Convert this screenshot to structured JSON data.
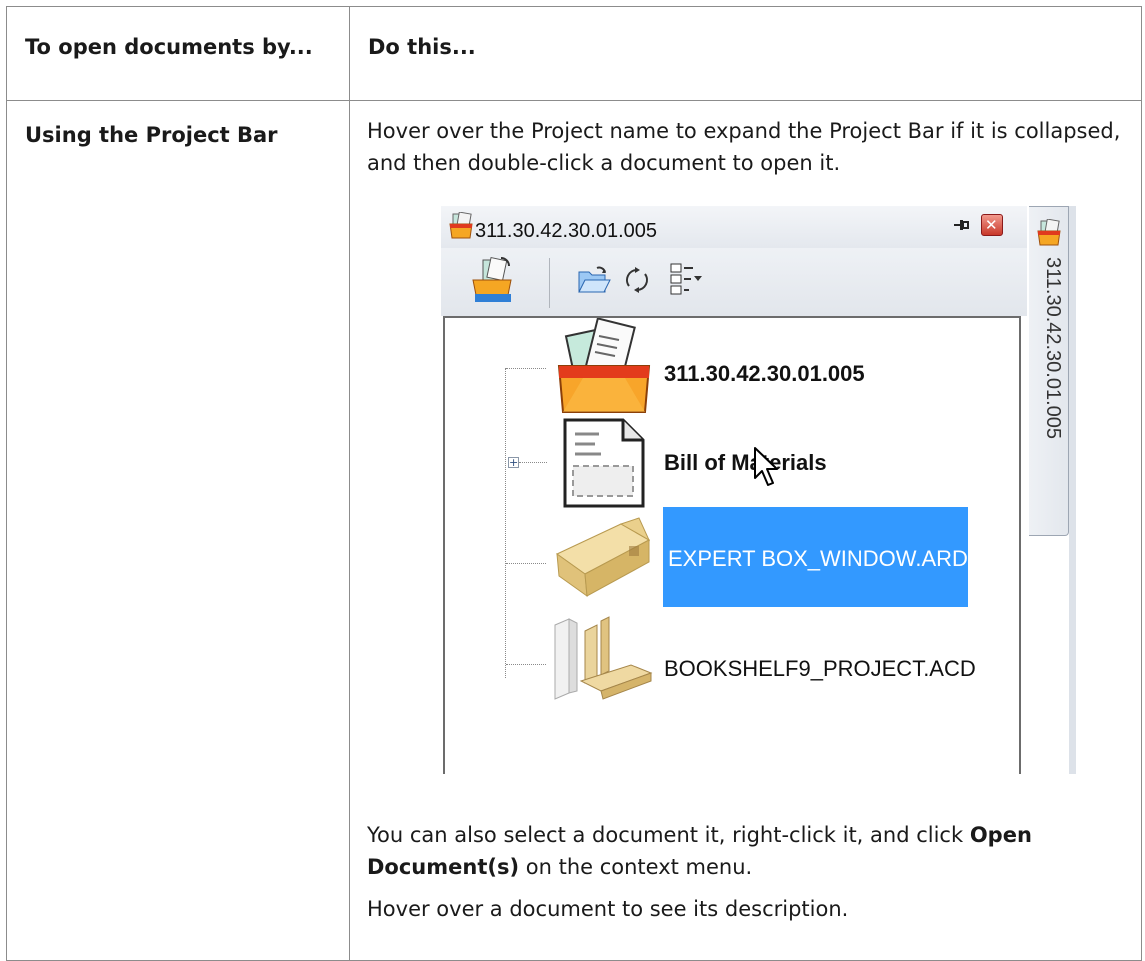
{
  "table": {
    "header_col1": "To open documents by...",
    "header_col2": "Do this...",
    "row_label": "Using the Project Bar",
    "intro": "Hover over the Project name to expand the Project Bar if it is collapsed, and then double-click a document to open it.",
    "also_before": "You can also select a document it, right-click it, and click ",
    "also_bold": "Open Document(s)",
    "also_after": " on the context menu.",
    "hover_note": "Hover over a document to see its description."
  },
  "project_bar": {
    "title": "311.30.42.30.01.005",
    "side_tab_label": "311.30.42.30.01.005",
    "toolbar_icons": [
      "project-open-icon",
      "folder-open-icon",
      "refresh-icon",
      "view-options-icon"
    ],
    "tree": [
      {
        "label": "311.30.42.30.01.005",
        "bold": true,
        "icon": "project-box-icon"
      },
      {
        "label": "Bill of Materials",
        "bold": true,
        "icon": "bill-of-materials-icon",
        "expandable": true
      },
      {
        "label": "EXPERT BOX_WINDOW.ARD",
        "bold": false,
        "icon": "box-3d-icon",
        "selected": true
      },
      {
        "label": "BOOKSHELF9_PROJECT.ACD",
        "bold": false,
        "icon": "bookshelf-icon"
      }
    ],
    "colors": {
      "selection": "#3399ff",
      "selection_text": "#ffffff"
    }
  }
}
